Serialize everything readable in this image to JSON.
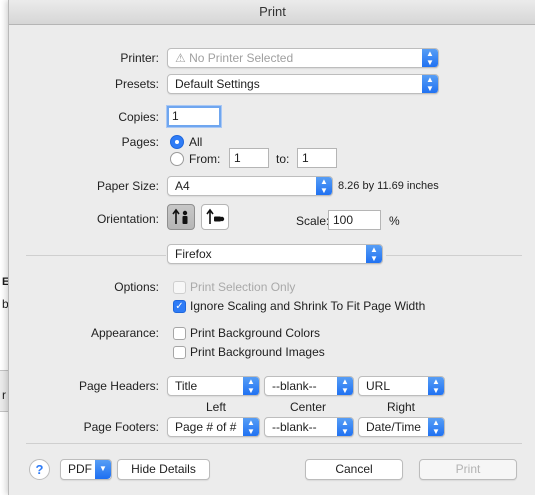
{
  "window": {
    "title": "Print"
  },
  "background": {
    "fragment1": "EI",
    "fragment2": "b",
    "fragment3": "r"
  },
  "printer": {
    "label": "Printer:",
    "value": "⚠ No Printer Selected"
  },
  "presets": {
    "label": "Presets:",
    "value": "Default Settings"
  },
  "copies": {
    "label": "Copies:",
    "value": "1"
  },
  "pages": {
    "label": "Pages:",
    "all_label": "All",
    "from_label": "From:",
    "from_value": "1",
    "to_label": "to:",
    "to_value": "1",
    "selected": "All"
  },
  "paper_size": {
    "label": "Paper Size:",
    "value": "A4",
    "dimensions": "8.26 by 11.69 inches"
  },
  "orientation": {
    "label": "Orientation:",
    "selected": "portrait"
  },
  "scale": {
    "label": "Scale:",
    "value": "100",
    "unit": "%"
  },
  "section_popup": {
    "value": "Firefox"
  },
  "options": {
    "label": "Options:",
    "print_selection_only": {
      "label": "Print Selection Only",
      "checked": false,
      "enabled": false
    },
    "ignore_scaling": {
      "label": "Ignore Scaling and Shrink To Fit Page Width",
      "checked": true
    }
  },
  "appearance": {
    "label": "Appearance:",
    "background_colors": {
      "label": "Print Background Colors",
      "checked": false
    },
    "background_images": {
      "label": "Print Background Images",
      "checked": false
    }
  },
  "headers": {
    "label": "Page Headers:",
    "left": "Title",
    "center": "--blank--",
    "right": "URL"
  },
  "columns": {
    "left": "Left",
    "center": "Center",
    "right": "Right"
  },
  "footers": {
    "label": "Page Footers:",
    "left": "Page # of #",
    "center": "--blank--",
    "right": "Date/Time"
  },
  "bottom": {
    "help": "?",
    "pdf": "PDF",
    "hide_details": "Hide Details",
    "cancel": "Cancel",
    "print": "Print"
  },
  "colors": {
    "accent": "#2f7cf6",
    "dialog_bg": "#ececec"
  }
}
